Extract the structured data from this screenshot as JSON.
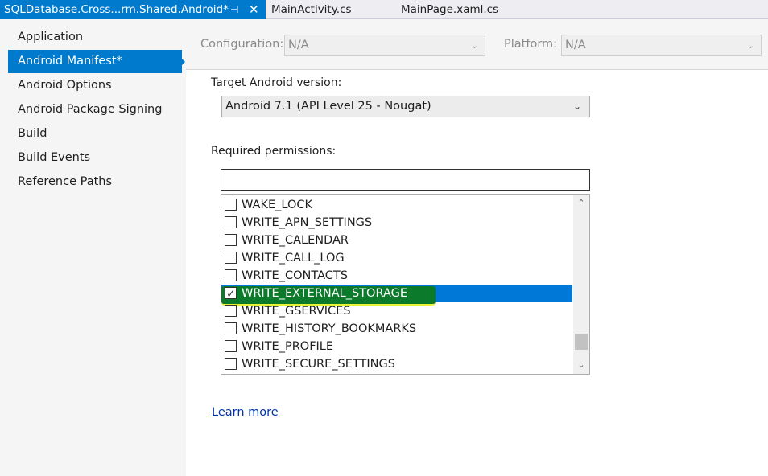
{
  "tabs": {
    "active_title": "SQLDatabase.Cross...rm.Shared.Android*",
    "pin_glyph": "⊣",
    "close_glyph": "✕",
    "tab2": "MainActivity.cs",
    "tab3": "MainPage.xaml.cs"
  },
  "nav": {
    "items": [
      "Application",
      "Android Manifest*",
      "Android Options",
      "Android Package Signing",
      "Build",
      "Build Events",
      "Reference Paths"
    ],
    "selected_index": 1
  },
  "config": {
    "configuration_label": "Configuration:",
    "configuration_value": "N/A",
    "platform_label": "Platform:",
    "platform_value": "N/A"
  },
  "target": {
    "label": "Target Android version:",
    "value": "Android 7.1 (API Level 25 - Nougat)"
  },
  "permissions": {
    "label": "Required permissions:",
    "filter_value": "",
    "items": [
      {
        "name": "WAKE_LOCK",
        "checked": false
      },
      {
        "name": "WRITE_APN_SETTINGS",
        "checked": false
      },
      {
        "name": "WRITE_CALENDAR",
        "checked": false
      },
      {
        "name": "WRITE_CALL_LOG",
        "checked": false
      },
      {
        "name": "WRITE_CONTACTS",
        "checked": false
      },
      {
        "name": "WRITE_EXTERNAL_STORAGE",
        "checked": true
      },
      {
        "name": "WRITE_GSERVICES",
        "checked": false
      },
      {
        "name": "WRITE_HISTORY_BOOKMARKS",
        "checked": false
      },
      {
        "name": "WRITE_PROFILE",
        "checked": false
      },
      {
        "name": "WRITE_SECURE_SETTINGS",
        "checked": false
      }
    ],
    "selected_index": 5
  },
  "learn_more": "Learn more",
  "colors": {
    "accent": "#007acc",
    "selection": "#0078d7",
    "highlighter": "#e6f014"
  }
}
